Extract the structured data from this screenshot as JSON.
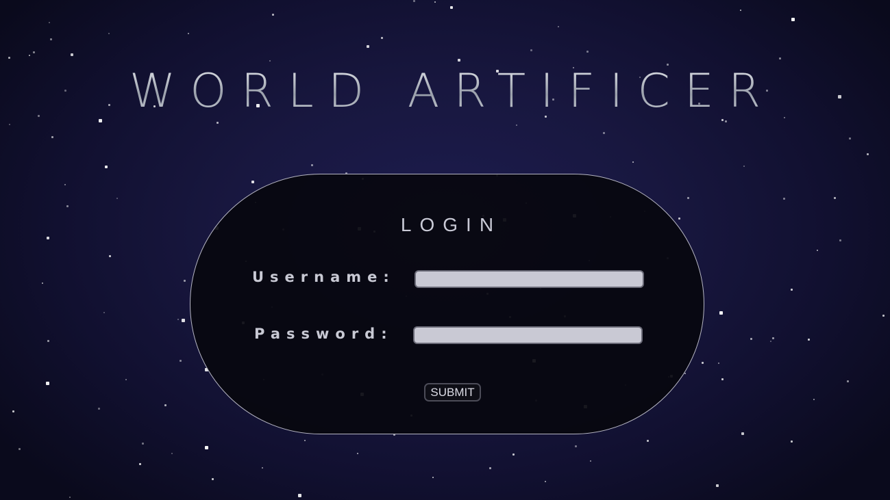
{
  "page": {
    "title": "WORLD ARTIFICER"
  },
  "login": {
    "heading": "LOGIN",
    "username_label": "Username:",
    "username_value": "",
    "password_label": "Password:",
    "password_value": "",
    "submit_label": "SUBMIT"
  },
  "theme": {
    "background": "#1a1a48",
    "panel": "#07070f",
    "panel_border": "#b7b7c4",
    "input_fill": "#c9c9d4",
    "label_text": "#c8c9d4"
  }
}
